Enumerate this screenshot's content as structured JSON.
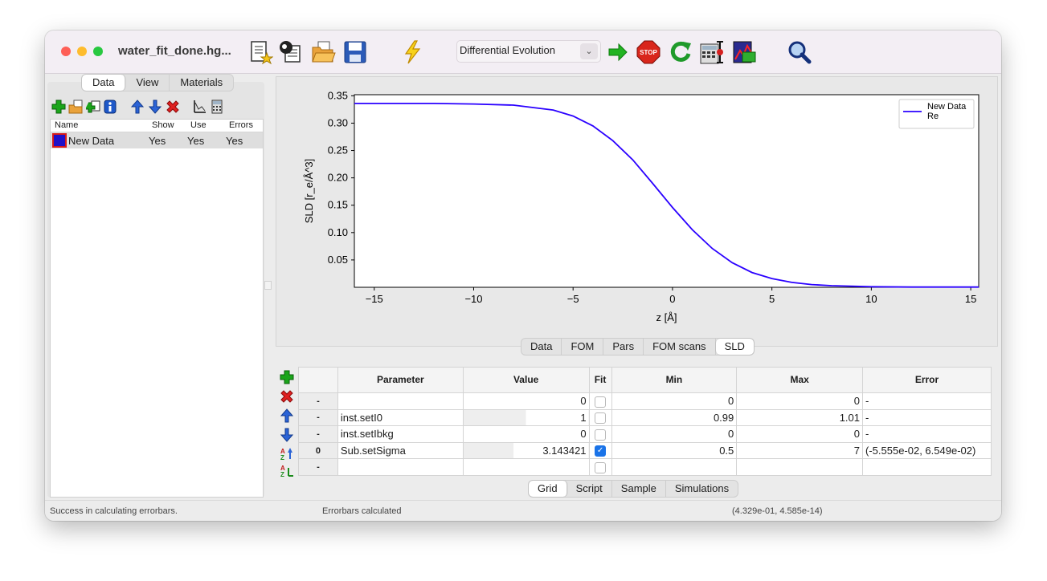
{
  "window": {
    "title": "water_fit_done.hg..."
  },
  "toolbar": {
    "algorithm_selected": "Differential Evolution",
    "icons": [
      "new-model-icon",
      "new-from-template-icon",
      "open-file-icon",
      "save-icon",
      "simulate-icon",
      "start-fit-icon",
      "stop-fit-icon",
      "restart-fit-icon",
      "calc-errorbars-icon",
      "parameter-scan-icon",
      "search-icon"
    ]
  },
  "left_panel": {
    "tabs": [
      "Data",
      "View",
      "Materials"
    ],
    "selected_tab": "Data",
    "columns": [
      "Name",
      "Show",
      "Use",
      "Errors"
    ],
    "rows": [
      {
        "name": "New Data",
        "show": "Yes",
        "use": "Yes",
        "errors": "Yes",
        "color": "#1f10c8"
      }
    ]
  },
  "plot_tabs": {
    "tabs": [
      "Data",
      "FOM",
      "Pars",
      "FOM scans",
      "SLD"
    ],
    "selected": "SLD"
  },
  "chart_data": {
    "type": "line",
    "title": "",
    "xlabel": "z [Å]",
    "ylabel": "SLD [r_e/Å^3]",
    "xlim": [
      -16,
      15.4
    ],
    "ylim": [
      0.0,
      0.352
    ],
    "xticks": [
      -15,
      -10,
      -5,
      0,
      5,
      10,
      15
    ],
    "xtick_labels": [
      "−15",
      "−10",
      "−5",
      "0",
      "5",
      "10",
      "15"
    ],
    "yticks": [
      0.05,
      0.1,
      0.15,
      0.2,
      0.25,
      0.3,
      0.35
    ],
    "ytick_labels": [
      "0.05",
      "0.10",
      "0.15",
      "0.20",
      "0.25",
      "0.30",
      "0.35"
    ],
    "legend_position": "top-right",
    "series": [
      {
        "name": "New Data Re",
        "color": "#2a00ff",
        "x": [
          -16,
          -14,
          -12,
          -10,
          -8,
          -6,
          -5,
          -4,
          -3,
          -2,
          -1,
          0,
          1,
          2,
          3,
          4,
          5,
          6,
          7,
          8,
          9,
          10,
          12,
          15.4
        ],
        "y": [
          0.336,
          0.336,
          0.336,
          0.335,
          0.333,
          0.324,
          0.313,
          0.295,
          0.268,
          0.233,
          0.19,
          0.146,
          0.105,
          0.071,
          0.045,
          0.027,
          0.016,
          0.009,
          0.005,
          0.003,
          0.002,
          0.001,
          0.0005,
          0.0005
        ]
      }
    ]
  },
  "grid": {
    "headers": [
      "Parameter",
      "Value",
      "Fit",
      "Min",
      "Max",
      "Error"
    ],
    "rows": [
      {
        "label": "-",
        "parameter": "",
        "value": "0",
        "fit": false,
        "min": "0",
        "max": "0",
        "error": "-"
      },
      {
        "label": "-",
        "parameter": "inst.setI0",
        "value": "1",
        "fit": false,
        "min": "0.99",
        "max": "1.01",
        "error": "-"
      },
      {
        "label": "-",
        "parameter": "inst.setIbkg",
        "value": "0",
        "fit": false,
        "min": "0",
        "max": "0",
        "error": "-"
      },
      {
        "label": "0",
        "parameter": "Sub.setSigma",
        "value": "3.143421",
        "fit": true,
        "min": "0.5",
        "max": "7",
        "error": "(-5.555e-02, 6.549e-02)"
      },
      {
        "label": "-",
        "parameter": "",
        "value": "",
        "fit": false,
        "min": "",
        "max": "",
        "error": ""
      }
    ]
  },
  "bottom_tabs": {
    "tabs": [
      "Grid",
      "Script",
      "Sample",
      "Simulations"
    ],
    "selected": "Grid"
  },
  "status": {
    "left": "Success in calculating errorbars.",
    "middle": "Errorbars calculated",
    "right": "(4.329e-01, 4.585e-14)"
  }
}
